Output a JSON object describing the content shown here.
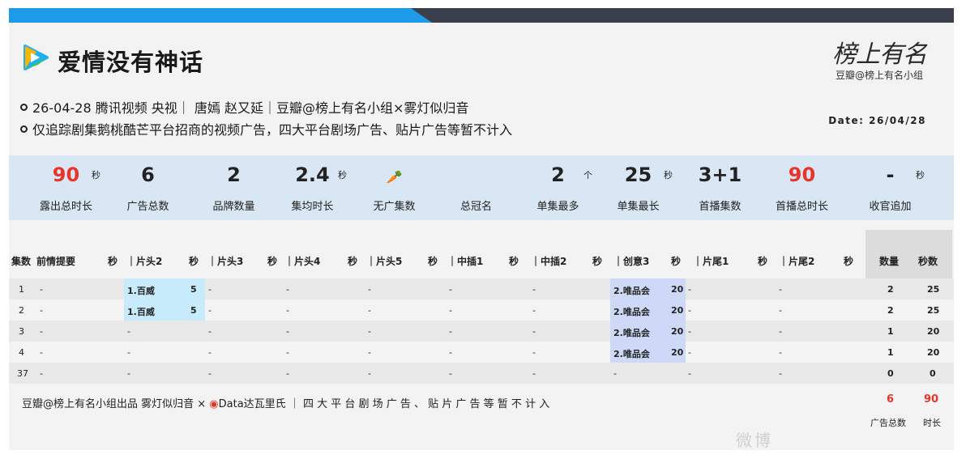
{
  "colors": {
    "blue_bar": "#1e9be8",
    "dark_bar": "#3a3f4b",
    "stats_bg": "#d8e7f3",
    "red": "#e8352a",
    "cyan_hl": "#c7ebfb",
    "lav_hl": "#cdd9f6"
  },
  "header": {
    "logo_icon": "tencent-video-play-icon",
    "title": "爱情没有神话",
    "info1": "26-04-28 腾讯视频 央视｜ 唐嫣 赵又延｜豆瓣@榜上有名小组×雾灯似归音",
    "info2": "仅追踪剧集鹅桃酷芒平台招商的视频广告，四大平台剧场广告、贴片广告等暂不计入",
    "brand_logo": "榜上有名",
    "brand_sub": "豆瓣@榜上有名小组",
    "date": "Date: 26/04/28"
  },
  "stats": [
    {
      "value": "90",
      "unit": "秒",
      "label": "露出总时长",
      "red": true
    },
    {
      "value": "6",
      "unit": "",
      "label": "广告总数",
      "red": false
    },
    {
      "value": "2",
      "unit": "",
      "label": "品牌数量",
      "red": false
    },
    {
      "value": "2.4",
      "unit": "秒",
      "label": "集均时长",
      "red": false
    },
    {
      "value": "",
      "unit": "",
      "label": "无广集数",
      "red": false,
      "icon": "carrot-icon"
    },
    {
      "value": "",
      "unit": "",
      "label": "总冠名",
      "red": false
    },
    {
      "value": "2",
      "unit": "个",
      "label": "单集最多",
      "red": false
    },
    {
      "value": "25",
      "unit": "秒",
      "label": "单集最长",
      "red": false
    },
    {
      "value": "3+1",
      "unit": "",
      "label": "首播集数",
      "red": false
    },
    {
      "value": "90",
      "unit": "",
      "label": "首播总时长",
      "red": true
    },
    {
      "value": "-",
      "unit": "秒",
      "label": "收官追加",
      "red": false
    }
  ],
  "table": {
    "headers": [
      "集数",
      "前情提要",
      "秒",
      "｜片头2",
      "秒",
      "｜片头3",
      "秒",
      "｜片头4",
      "秒",
      "｜片头5",
      "秒",
      "｜中插1",
      "秒",
      "｜中插2",
      "秒",
      "｜创意3",
      "秒",
      "｜片尾1",
      "秒",
      "｜片尾2",
      "秒",
      "数量",
      "秒数"
    ],
    "rows": [
      {
        "ep": "1",
        "c1": "-",
        "c2": "1.百威",
        "c2s": "5",
        "c3": "-",
        "c4": "-",
        "c5": "-",
        "c6": "-",
        "c7": "-",
        "c8": "2.唯品会",
        "c8s": "20",
        "c9": "-",
        "c10": "-",
        "count": "2",
        "secs": "25"
      },
      {
        "ep": "2",
        "c1": "-",
        "c2": "1.百威",
        "c2s": "5",
        "c3": "-",
        "c4": "-",
        "c5": "-",
        "c6": "-",
        "c7": "-",
        "c8": "2.唯品会",
        "c8s": "20",
        "c9": "-",
        "c10": "-",
        "count": "2",
        "secs": "25"
      },
      {
        "ep": "3",
        "c1": "-",
        "c2": "-",
        "c2s": "",
        "c3": "-",
        "c4": "-",
        "c5": "-",
        "c6": "-",
        "c7": "-",
        "c8": "2.唯品会",
        "c8s": "20",
        "c9": "-",
        "c10": "-",
        "count": "1",
        "secs": "20"
      },
      {
        "ep": "4",
        "c1": "-",
        "c2": "-",
        "c2s": "",
        "c3": "-",
        "c4": "-",
        "c5": "-",
        "c6": "-",
        "c7": "-",
        "c8": "2.唯品会",
        "c8s": "20",
        "c9": "-",
        "c10": "-",
        "count": "1",
        "secs": "20"
      },
      {
        "ep": "37",
        "c1": "-",
        "c2": "-",
        "c2s": "",
        "c3": "-",
        "c4": "-",
        "c5": "-",
        "c6": "-",
        "c7": "-",
        "c8": "-",
        "c8s": "",
        "c9": "-",
        "c10": "-",
        "count": "0",
        "secs": "0"
      }
    ]
  },
  "footer": {
    "text": "豆瓣@榜上有名小组出品  雾灯似归音 × ",
    "weibo_icon": "weibo-icon",
    "text2": "Data达瓦里氏 ｜ 四 大 平 台 剧 场 广 告 、 贴 片 广 告 等 暂 不 计 入",
    "total_count": "6",
    "total_secs": "90",
    "total_count_label": "广告总数",
    "total_secs_label": "时长"
  },
  "watermark": "微博"
}
